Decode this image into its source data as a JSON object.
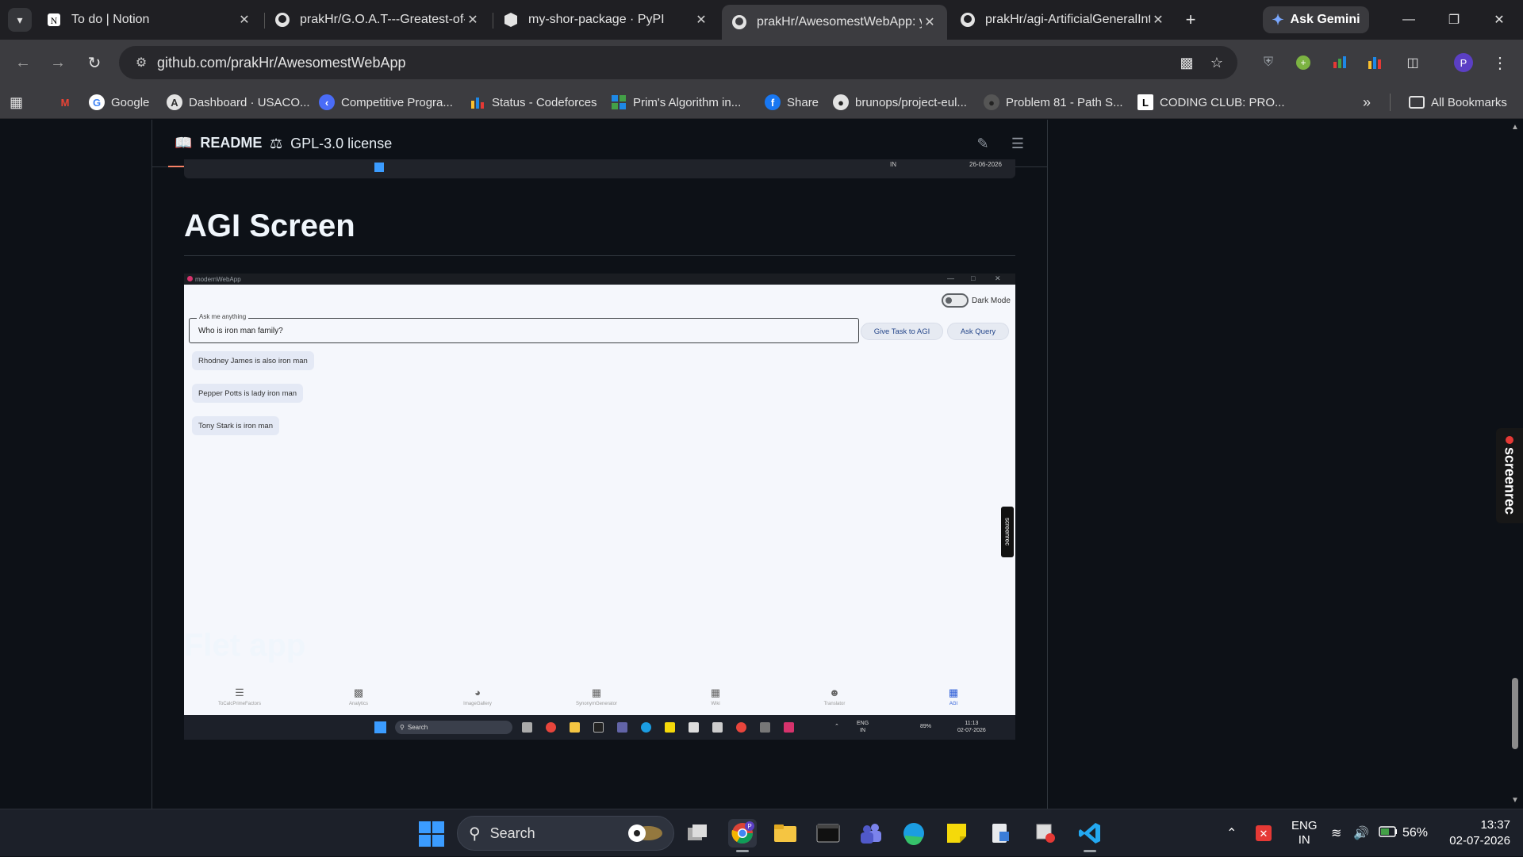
{
  "tabs": [
    {
      "label": "To do | Notion",
      "icon": "notion-icon"
    },
    {
      "label": "prakHr/G.O.A.T---Greatest-of-All-Time",
      "icon": "github-icon"
    },
    {
      "label": "my-shor-package · PyPI",
      "icon": "pypi-icon"
    },
    {
      "label": "prakHr/AwesomestWebApp: your",
      "icon": "github-icon",
      "active": true
    },
    {
      "label": "prakHr/agi-ArtificialGeneralIntelligence",
      "icon": "github-icon"
    }
  ],
  "gemini_label": "Ask Gemini",
  "address": "github.com/prakHr/AwesomestWebApp",
  "bookmarks": [
    {
      "label": "Google"
    },
    {
      "label": "Dashboard · USACO..."
    },
    {
      "label": "Competitive Progra..."
    },
    {
      "label": "Status - Codeforces"
    },
    {
      "label": "Prim's Algorithm in..."
    },
    {
      "label": "Share"
    },
    {
      "label": "brunops/project-eul..."
    },
    {
      "label": "Problem 81 - Path S..."
    },
    {
      "label": "CODING CLUB: PRO..."
    }
  ],
  "all_bookmarks": "All Bookmarks",
  "readme": {
    "tab_readme": "README",
    "tab_license": "GPL-3.0 license",
    "heading_agi": "AGI Screen",
    "heading_flet": "Flet app"
  },
  "prev_strip": {
    "lang": "IN",
    "date": "26-06-2026"
  },
  "shot": {
    "window_title": "modernWebApp",
    "dark_mode": "Dark Mode",
    "ask_caption": "Ask me anything",
    "ask_value": "Who is iron man family?",
    "btn_task": "Give Task to AGI",
    "btn_query": "Ask Query",
    "answers": [
      "Rhodney James is also iron man",
      "Pepper Potts is lady iron man",
      "Tony Stark is iron man"
    ],
    "screenrec": "screenrec",
    "nav": [
      {
        "label": "ToCalcPrimeFactors",
        "icon": "checklist-icon"
      },
      {
        "label": "Analytics",
        "icon": "analytics-icon"
      },
      {
        "label": "ImageGallery",
        "icon": "gallery-icon"
      },
      {
        "label": "SynonymGenerator",
        "icon": "synonym-icon"
      },
      {
        "label": "Wiki",
        "icon": "wiki-icon"
      },
      {
        "label": "Translator",
        "icon": "translator-icon"
      },
      {
        "label": "AGI",
        "icon": "agi-icon",
        "selected": true
      }
    ],
    "taskbar_search": "Search",
    "tray_lang_1": "ENG",
    "tray_lang_2": "IN",
    "battery": "89%",
    "time": "11:13",
    "date": "02-07-2026"
  },
  "screenrec": "screenrec",
  "taskbar": {
    "search": "Search",
    "lang_1": "ENG",
    "lang_2": "IN",
    "battery": "56%",
    "time": "13:37",
    "date": "02-07-2026"
  },
  "colors": {
    "page_bg": "#0d1117",
    "accent_tab": "#f78166",
    "chrome_bg": "#3c3c40"
  }
}
